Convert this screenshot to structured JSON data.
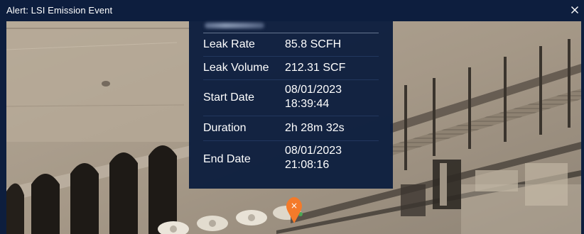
{
  "window": {
    "title": "Alert: LSI Emission Event",
    "close_icon": "close-icon"
  },
  "popup": {
    "rows": [
      {
        "label": "Leak Rate",
        "value": "85.8 SCFH"
      },
      {
        "label": "Leak Volume",
        "value": "212.31 SCF"
      },
      {
        "label": "Start Date",
        "value": "08/01/2023\n18:39:44"
      },
      {
        "label": "Duration",
        "value": "2h 28m 32s"
      },
      {
        "label": "End Date",
        "value": "08/01/2023\n21:08:16"
      }
    ]
  },
  "map": {
    "marker_icon": "location-pin-icon",
    "marker_color": "#f47a2a",
    "marker_glyph": "×",
    "background_icon": "satellite-imagery"
  },
  "colors": {
    "frame": "#0d1e3e",
    "popup_bg": "#0d1e3e",
    "text": "#ffffff",
    "divider": "#66758f"
  }
}
